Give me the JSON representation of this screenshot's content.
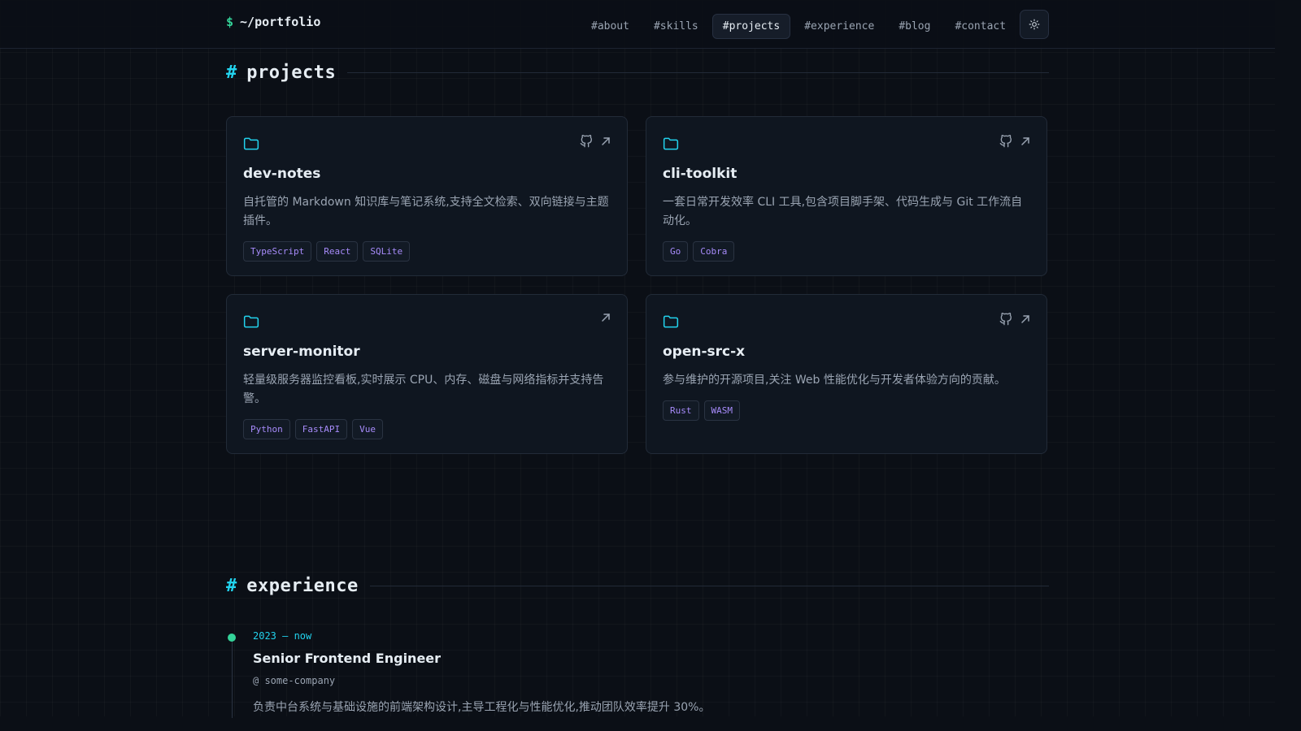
{
  "header": {
    "logo_prompt": "$",
    "logo_text": "~/portfolio",
    "nav": [
      {
        "label": "#about",
        "active": false
      },
      {
        "label": "#skills",
        "active": false
      },
      {
        "label": "#projects",
        "active": true
      },
      {
        "label": "#experience",
        "active": false
      },
      {
        "label": "#blog",
        "active": false
      },
      {
        "label": "#contact",
        "active": false
      }
    ],
    "theme_toggle_icon": "sun-icon"
  },
  "projects": {
    "hash": "#",
    "title": "projects",
    "items": [
      {
        "name": "dev-notes",
        "description": "自托管的 Markdown 知识库与笔记系统,支持全文检索、双向链接与主题插件。",
        "tags": [
          "TypeScript",
          "React",
          "SQLite"
        ],
        "icons": [
          "folder-icon",
          "github-icon",
          "external-link-icon"
        ]
      },
      {
        "name": "cli-toolkit",
        "description": "一套日常开发效率 CLI 工具,包含项目脚手架、代码生成与 Git 工作流自动化。",
        "tags": [
          "Go",
          "Cobra"
        ],
        "icons": [
          "folder-icon",
          "github-icon",
          "external-link-icon"
        ]
      },
      {
        "name": "server-monitor",
        "description": "轻量级服务器监控看板,实时展示 CPU、内存、磁盘与网络指标并支持告警。",
        "tags": [
          "Python",
          "FastAPI",
          "Vue"
        ],
        "icons": [
          "folder-icon",
          "external-link-icon"
        ]
      },
      {
        "name": "open-src-x",
        "description": "参与维护的开源项目,关注 Web 性能优化与开发者体验方向的贡献。",
        "tags": [
          "Rust",
          "WASM"
        ],
        "icons": [
          "folder-icon",
          "github-icon",
          "external-link-icon"
        ]
      }
    ]
  },
  "experience": {
    "hash": "#",
    "title": "experience",
    "items": [
      {
        "period": "2023 — now",
        "role": "Senior Frontend Engineer",
        "company": "@ some-company",
        "description": "负责中台系统与基础设施的前端架构设计,主导工程化与性能优化,推动团队效率提升 30%。"
      }
    ]
  },
  "colors": {
    "background": "#0b0f16",
    "accent_cyan": "#22d3ee",
    "accent_green": "#34d399",
    "tag_purple": "#a78bfa"
  }
}
